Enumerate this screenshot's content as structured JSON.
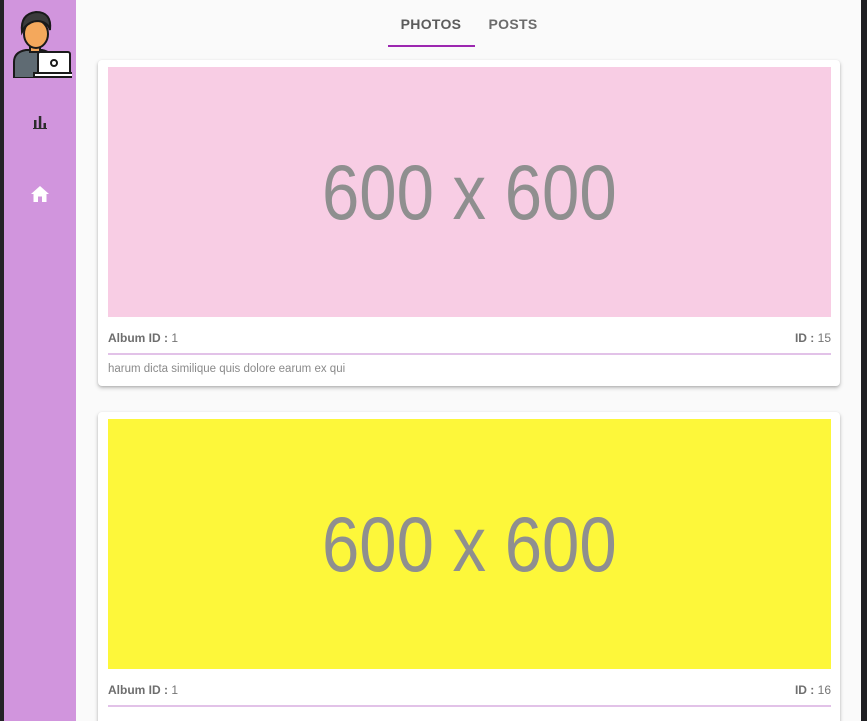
{
  "tabs": [
    {
      "label": "PHOTOS",
      "active": true
    },
    {
      "label": "POSTS",
      "active": false
    }
  ],
  "sidebar": {
    "avatar": "developer-avatar",
    "items": [
      {
        "icon": "bar-chart-icon"
      },
      {
        "icon": "home-icon"
      }
    ]
  },
  "photos": [
    {
      "placeholder_text": "600 x 600",
      "color": "#f8cde4",
      "album_label": "Album ID :",
      "album_id": "1",
      "id_label": "ID :",
      "id": "15",
      "title": "harum dicta similique quis dolore earum ex qui"
    },
    {
      "placeholder_text": "600 x 600",
      "color": "#fdf73a",
      "album_label": "Album ID :",
      "album_id": "1",
      "id_label": "ID :",
      "id": "16",
      "title": ""
    }
  ],
  "colors": {
    "sidebar": "#d195dd",
    "accent": "#9c27b0",
    "background": "#fafafa"
  }
}
